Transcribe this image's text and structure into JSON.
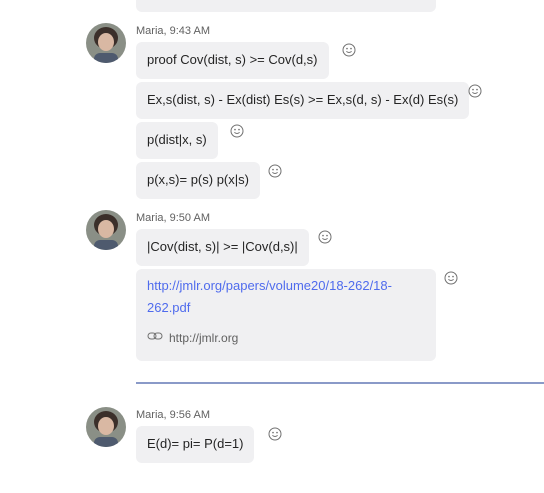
{
  "messages": [
    {
      "sender_time": "Maria, 9:43 AM",
      "texts": [
        "proof Cov(dist, s) >= Cov(d,s)",
        "Ex,s(dist, s) - Ex(dist) Es(s) >= Ex,s(d, s) - Ex(d) Es(s)",
        "p(dist|x, s)",
        "p(x,s)= p(s) p(x|s)"
      ]
    },
    {
      "sender_time": "Maria, 9:50 AM",
      "texts": [
        "|Cov(dist, s)| >= |Cov(d,s)|"
      ],
      "link": {
        "url": "http://jmlr.org/papers/volume20/18-262/18-262.pdf",
        "url_line1": "http://jmlr.org/papers/volume20/18-262/18-",
        "url_line2": "262.pdf",
        "domain": "http://jmlr.org"
      }
    },
    {
      "sender_time": "Maria, 9:56 AM",
      "texts": [
        "E(d)= pi= P(d=1)"
      ]
    }
  ],
  "icons": {
    "reaction": "smiley-icon",
    "link": "link-icon",
    "avatar": "avatar"
  },
  "colors": {
    "bubble": "#f0f0f2",
    "link": "#4f6bed",
    "divider": "#8a9ac8"
  }
}
